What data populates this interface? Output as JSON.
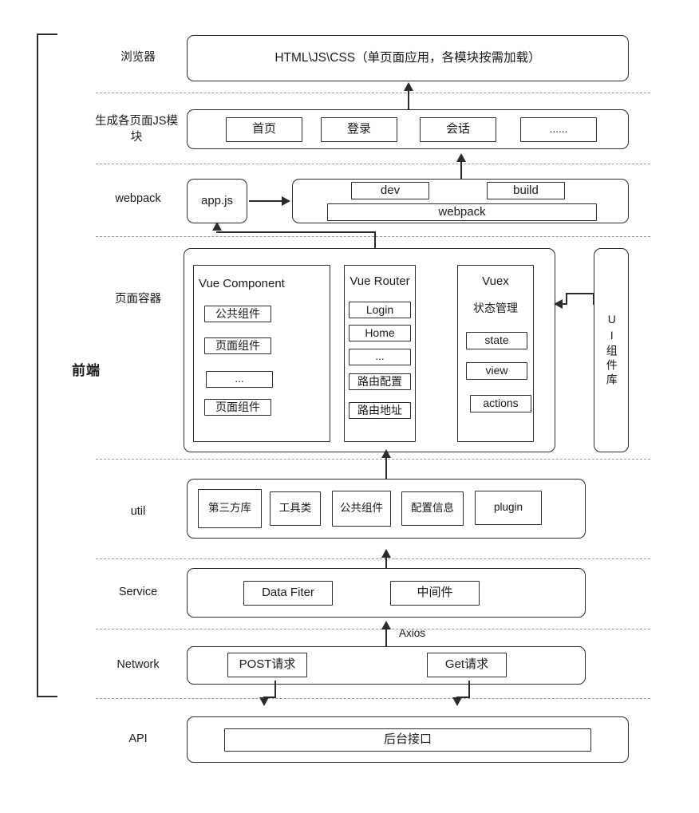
{
  "diagram": {
    "title_label": "前端",
    "layers": [
      {
        "id": "browser",
        "label": "浏览器"
      },
      {
        "id": "page-js",
        "label": "生成各页面JS模块"
      },
      {
        "id": "webpack",
        "label": "webpack"
      },
      {
        "id": "container",
        "label": "页面容器"
      },
      {
        "id": "util",
        "label": "util"
      },
      {
        "id": "service",
        "label": "Service"
      },
      {
        "id": "network",
        "label": "Network"
      },
      {
        "id": "api",
        "label": "API"
      }
    ],
    "browser": {
      "main_box": "HTML\\JS\\CSS（单页面应用，各模块按需加载）"
    },
    "page_js": {
      "modules": [
        "首页",
        "登录",
        "会话",
        "......"
      ]
    },
    "webpack": {
      "entry": "app.js",
      "dev": "dev",
      "build": "build",
      "bundler": "webpack"
    },
    "container": {
      "vue_component": {
        "title": "Vue Component",
        "items": [
          "公共组件",
          "页面组件",
          "...",
          "页面组件"
        ]
      },
      "vue_router": {
        "title": "Vue Router",
        "items": [
          "Login",
          "Home",
          "...",
          "路由配置",
          "路由地址"
        ]
      },
      "vuex": {
        "title": "Vuex",
        "subtitle": "状态管理",
        "items": [
          "state",
          "view",
          "actions"
        ]
      },
      "ui_library": "UI组件库"
    },
    "util": {
      "items": [
        "第三方库",
        "工具类",
        "公共组件",
        "配置信息",
        "plugin"
      ]
    },
    "service": {
      "items": [
        "Data Fiter",
        "中间件"
      ]
    },
    "network": {
      "items": [
        "POST请求",
        "Get请求"
      ],
      "connector_label": "Axios"
    },
    "api": {
      "backend": "后台接口"
    },
    "colors": {
      "stroke": "#2b2b2b",
      "divider": "#9a9a9a",
      "background": "#ffffff",
      "text": "#1a1a1a"
    }
  }
}
